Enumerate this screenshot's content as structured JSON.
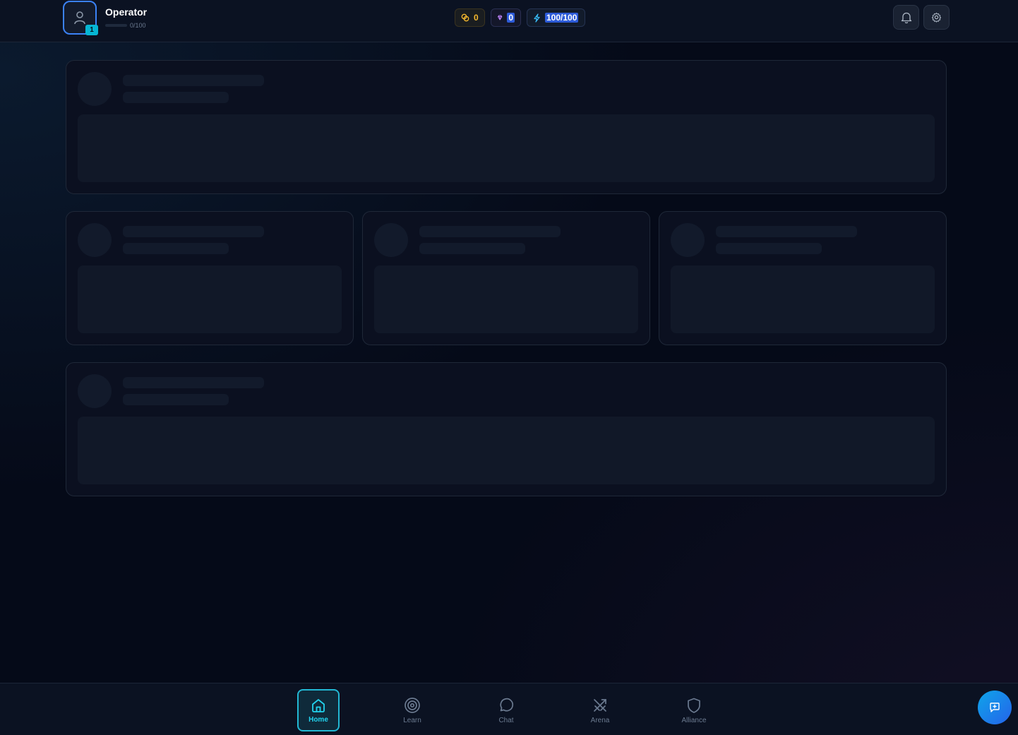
{
  "header": {
    "username": "Operator",
    "level": "1",
    "xp_text": "0/100",
    "xp_progress": 0,
    "gold": "0",
    "gems": "0",
    "energy": "100/100"
  },
  "nav": {
    "items": [
      {
        "label": "Home",
        "icon": "home-icon",
        "active": true
      },
      {
        "label": "Learn",
        "icon": "target-icon",
        "active": false
      },
      {
        "label": "Chat",
        "icon": "chat-bubble-icon",
        "active": false
      },
      {
        "label": "Arena",
        "icon": "crossed-swords-icon",
        "active": false
      },
      {
        "label": "Alliance",
        "icon": "shield-icon",
        "active": false
      }
    ]
  },
  "colors": {
    "accent": "#22d3ee",
    "gold": "#f5b82e",
    "gem": "#c084fc",
    "energy": "#38bdf8",
    "avatar_border": "#3b82f6"
  }
}
